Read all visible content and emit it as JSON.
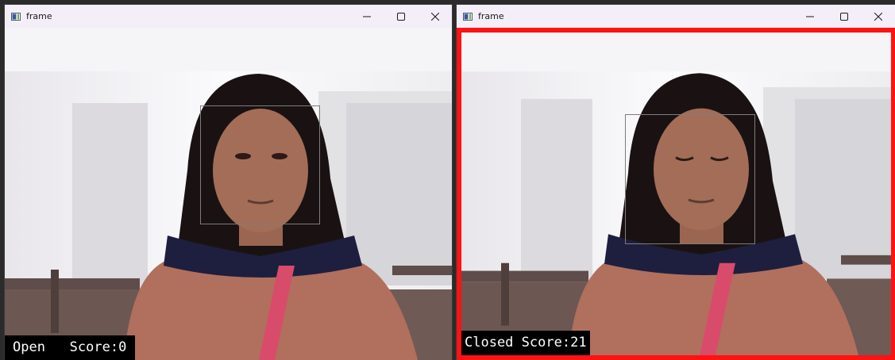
{
  "windows": [
    {
      "title": "frame",
      "status": "Open",
      "score_label": "Score:0",
      "alert_border_color": ""
    },
    {
      "title": "frame",
      "status": "Closed",
      "score_label": "Score:21",
      "alert_border_color": "#ff1212"
    }
  ],
  "icons": {
    "app": "app-window-icon",
    "minimize": "minimize-icon",
    "maximize": "maximize-icon",
    "close": "close-icon"
  },
  "colors": {
    "titlebar": "#f3eef7",
    "alert": "#ff1212",
    "label_bg": "#000000",
    "label_fg": "#ffffff"
  }
}
